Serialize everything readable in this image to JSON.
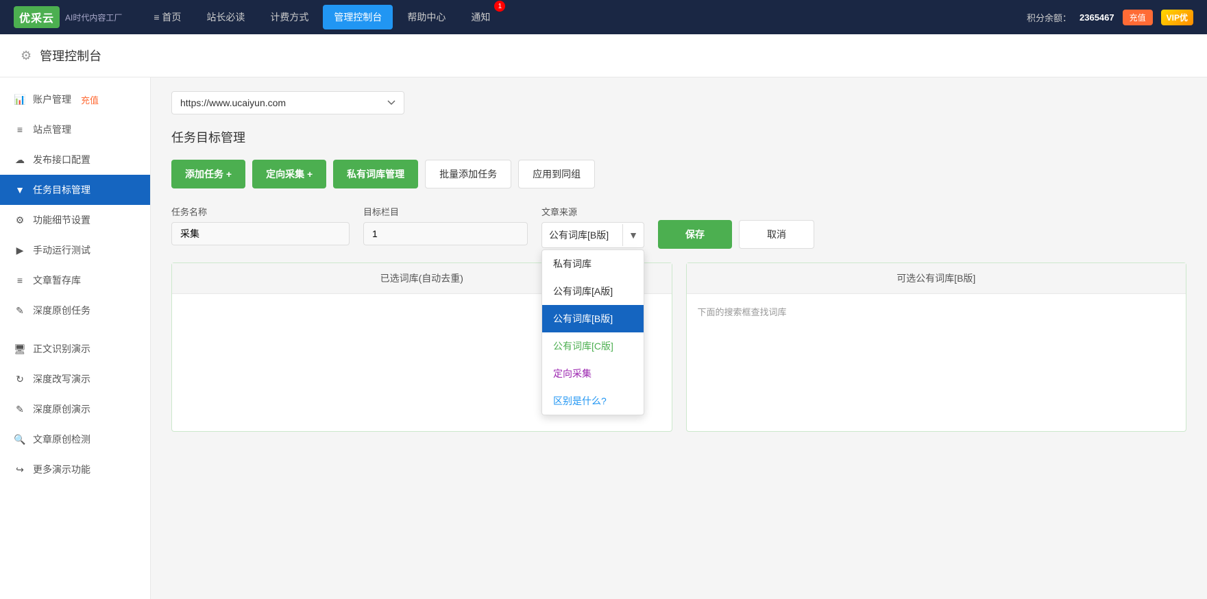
{
  "topnav": {
    "logo_text": "优采云",
    "logo_subtitle": "AI时代内容工厂",
    "nav_items": [
      {
        "label": "≡ 首页",
        "active": false
      },
      {
        "label": "站长必读",
        "active": false
      },
      {
        "label": "计费方式",
        "active": false
      },
      {
        "label": "管理控制台",
        "active": true
      },
      {
        "label": "帮助中心",
        "active": false
      },
      {
        "label": "通知",
        "active": false
      }
    ],
    "notif_count": "1",
    "points_label": "积分余额：",
    "points_value": "2365467",
    "charge_btn": "充值",
    "vip_label": "VIP优"
  },
  "page_header": {
    "title": "管理控制台"
  },
  "sidebar": {
    "items": [
      {
        "id": "account",
        "icon": "📊",
        "label": "账户管理",
        "has_recharge": true,
        "recharge_text": "充值",
        "active": false
      },
      {
        "id": "site",
        "icon": "≡",
        "label": "站点管理",
        "active": false
      },
      {
        "id": "publish",
        "icon": "☁",
        "label": "发布接口配置",
        "active": false
      },
      {
        "id": "task",
        "icon": "▼",
        "label": "任务目标管理",
        "active": true
      },
      {
        "id": "feature",
        "icon": "⚙",
        "label": "功能细节设置",
        "active": false
      },
      {
        "id": "manual",
        "icon": "▶",
        "label": "手动运行测试",
        "active": false
      },
      {
        "id": "draft",
        "icon": "≡",
        "label": "文章暂存库",
        "active": false
      },
      {
        "id": "original",
        "icon": "✎",
        "label": "深度原创任务",
        "active": false
      },
      {
        "id": "sep",
        "icon": "",
        "label": "",
        "active": false
      },
      {
        "id": "ocr",
        "icon": "🖥",
        "label": "正文识别演示",
        "active": false
      },
      {
        "id": "rewrite",
        "icon": "↻",
        "label": "深度改写演示",
        "active": false
      },
      {
        "id": "orig_demo",
        "icon": "✎",
        "label": "深度原创演示",
        "active": false
      },
      {
        "id": "check",
        "icon": "🔍",
        "label": "文章原创检测",
        "active": false
      },
      {
        "id": "more",
        "icon": "↪",
        "label": "更多演示功能",
        "active": false
      }
    ]
  },
  "main": {
    "site_url": "https://www.ucaiyun.com",
    "site_options": [
      {
        "value": "https://www.ucaiyun.com",
        "label": "https://www.ucaiyun.com"
      }
    ],
    "section_title": "任务目标管理",
    "action_buttons": {
      "add_task": "添加任务 +",
      "targeted_collect": "定向采集 +",
      "private_lib": "私有词库管理",
      "batch_add": "批量添加任务",
      "apply_group": "应用到同组"
    },
    "form": {
      "task_name_label": "任务名称",
      "task_name_value": "采集",
      "target_col_label": "目标栏目",
      "target_col_value": "1",
      "source_label": "文章来源",
      "source_value": "公有词库[B版]",
      "save_btn": "保存",
      "cancel_btn": "取消"
    },
    "dropdown": {
      "options": [
        {
          "label": "私有词库",
          "type": "normal",
          "selected": false
        },
        {
          "label": "公有词库[A版]",
          "type": "normal",
          "selected": false
        },
        {
          "label": "公有词库[B版]",
          "type": "selected",
          "selected": true
        },
        {
          "label": "公有词库[C版]",
          "type": "green",
          "selected": false
        },
        {
          "label": "定向采集",
          "type": "purple",
          "selected": false
        },
        {
          "label": "区别是什么?",
          "type": "blue-link",
          "selected": false
        }
      ]
    },
    "panels": {
      "left_header": "已选词库(自动去重)",
      "right_header": "可选公有词库[B版]",
      "right_hint": "下面的搜索框查找词库"
    }
  }
}
